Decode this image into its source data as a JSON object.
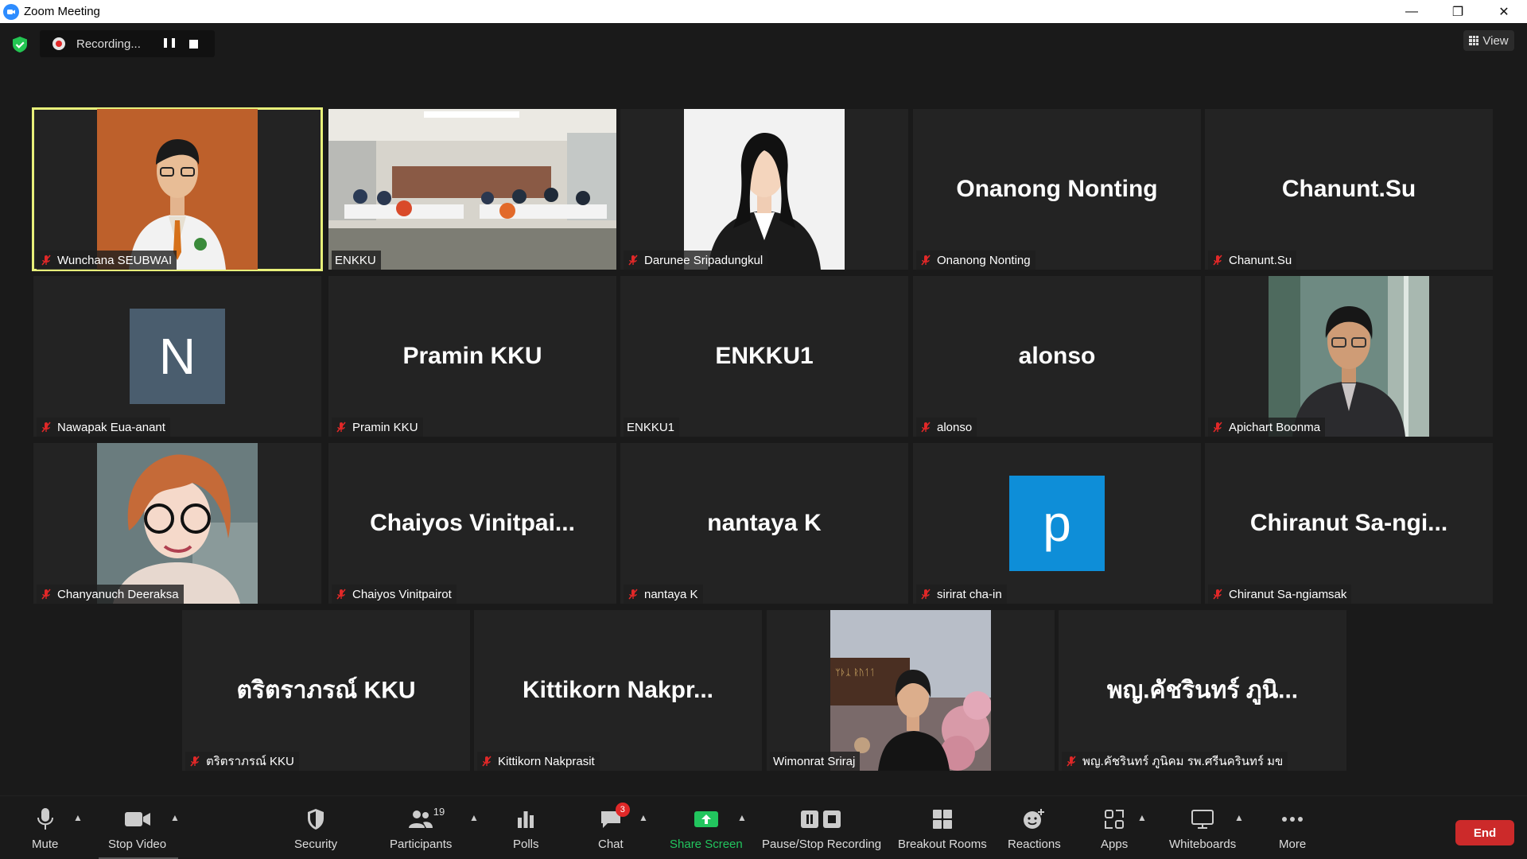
{
  "window": {
    "title": "Zoom Meeting"
  },
  "recording": {
    "label": "Recording..."
  },
  "view_button": {
    "label": "View"
  },
  "tiles": [
    {
      "name": "Wunchana SEUBWAI",
      "big": "",
      "muted": true,
      "type": "photo"
    },
    {
      "name": "ENKKU",
      "big": "",
      "muted": false,
      "type": "room"
    },
    {
      "name": "Darunee Sripadungkul",
      "big": "",
      "muted": true,
      "type": "photo"
    },
    {
      "name": "Onanong Nonting",
      "big": "Onanong Nonting",
      "muted": true,
      "type": "text"
    },
    {
      "name": "Chanunt.Su",
      "big": "Chanunt.Su",
      "muted": true,
      "type": "text"
    },
    {
      "name": "Nawapak Eua-anant",
      "big": "N",
      "muted": true,
      "type": "avatar",
      "avatar_color": "#4a5d6e"
    },
    {
      "name": "Pramin KKU",
      "big": "Pramin KKU",
      "muted": true,
      "type": "text"
    },
    {
      "name": "ENKKU1",
      "big": "ENKKU1",
      "muted": false,
      "type": "text"
    },
    {
      "name": "alonso",
      "big": "alonso",
      "muted": true,
      "type": "text"
    },
    {
      "name": "Apichart Boonma",
      "big": "",
      "muted": true,
      "type": "photo"
    },
    {
      "name": "Chanyanuch Deeraksa",
      "big": "",
      "muted": true,
      "type": "photo"
    },
    {
      "name": "Chaiyos Vinitpairot",
      "big": "Chaiyos  Vinitpai...",
      "muted": true,
      "type": "text"
    },
    {
      "name": "nantaya K",
      "big": "nantaya K",
      "muted": true,
      "type": "text"
    },
    {
      "name": "sirirat cha-in",
      "big": "p",
      "muted": true,
      "type": "avatar",
      "avatar_color": "#0e8ed8"
    },
    {
      "name": "Chiranut Sa-ngiamsak",
      "big": "Chiranut  Sa-ngi...",
      "muted": true,
      "type": "text"
    },
    {
      "name": "ตริตราภรณ์ KKU",
      "big": "ตริตราภรณ์ KKU",
      "muted": true,
      "type": "text"
    },
    {
      "name": "Kittikorn Nakprasit",
      "big": "Kittikorn  Nakpr...",
      "muted": true,
      "type": "text"
    },
    {
      "name": "Wimonrat Sriraj",
      "big": "",
      "muted": false,
      "type": "photo"
    },
    {
      "name": "พญ.คัชรินทร์ ภูนิคม รพ.ศรีนครินทร์ มข",
      "big": "พญ.คัชรินทร์ ภูนิ...",
      "muted": true,
      "type": "text"
    }
  ],
  "toolbar": {
    "mute": "Mute",
    "stop_video": "Stop Video",
    "security": "Security",
    "participants": "Participants",
    "participants_count": "19",
    "polls": "Polls",
    "chat": "Chat",
    "chat_badge": "3",
    "share_screen": "Share Screen",
    "pause_stop_recording": "Pause/Stop Recording",
    "breakout_rooms": "Breakout Rooms",
    "reactions": "Reactions",
    "apps": "Apps",
    "whiteboards": "Whiteboards",
    "more": "More",
    "end": "End"
  },
  "colors": {
    "active_border": "#e8f07a",
    "share_green": "#22c55e",
    "end_red": "#cc2a2a",
    "mute_red": "#e02828"
  }
}
